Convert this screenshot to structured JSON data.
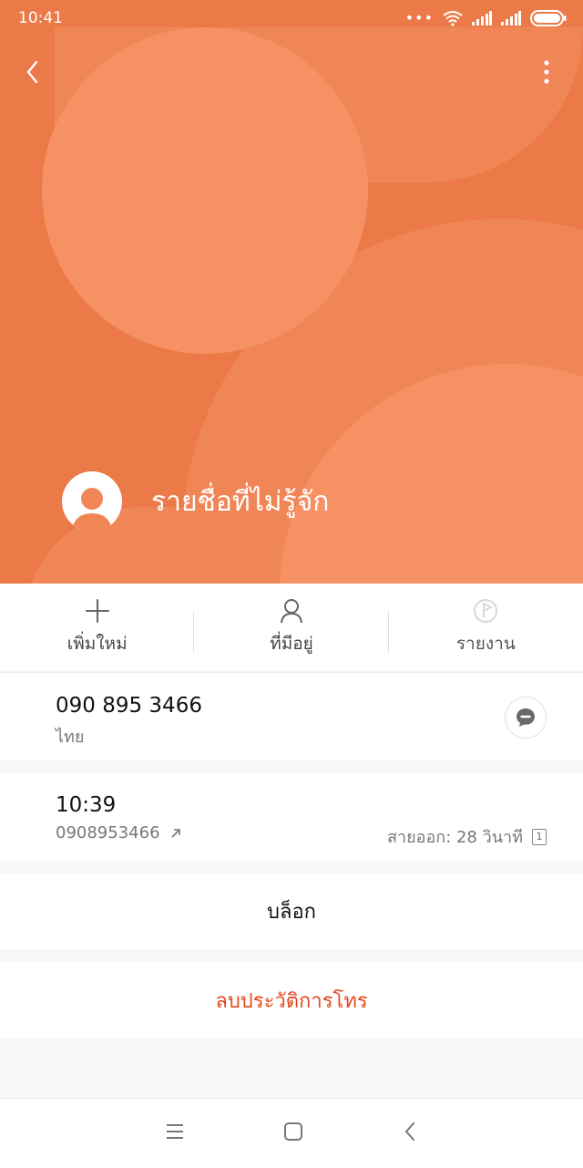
{
  "status_bar": {
    "time": "10:41"
  },
  "contact": {
    "name": "รายชื่อที่ไม่รู้จัก"
  },
  "actions": [
    {
      "label": "เพิ่มใหม่",
      "icon": "plus-icon"
    },
    {
      "label": "ที่มีอยู่",
      "icon": "person-icon"
    },
    {
      "label": "รายงาน",
      "icon": "report-flag-icon"
    }
  ],
  "number": {
    "value": "090 895 3466",
    "location": "ไทย"
  },
  "call_log": {
    "time": "10:39",
    "number": "0908953466",
    "duration": "สายออก: 28 วินาที",
    "sim": "1"
  },
  "block_label": "บล็อก",
  "delete_label": "ลบประวัติการโทร",
  "colors": {
    "hero": "#ec7a48",
    "accent_red": "#e24a1e"
  }
}
